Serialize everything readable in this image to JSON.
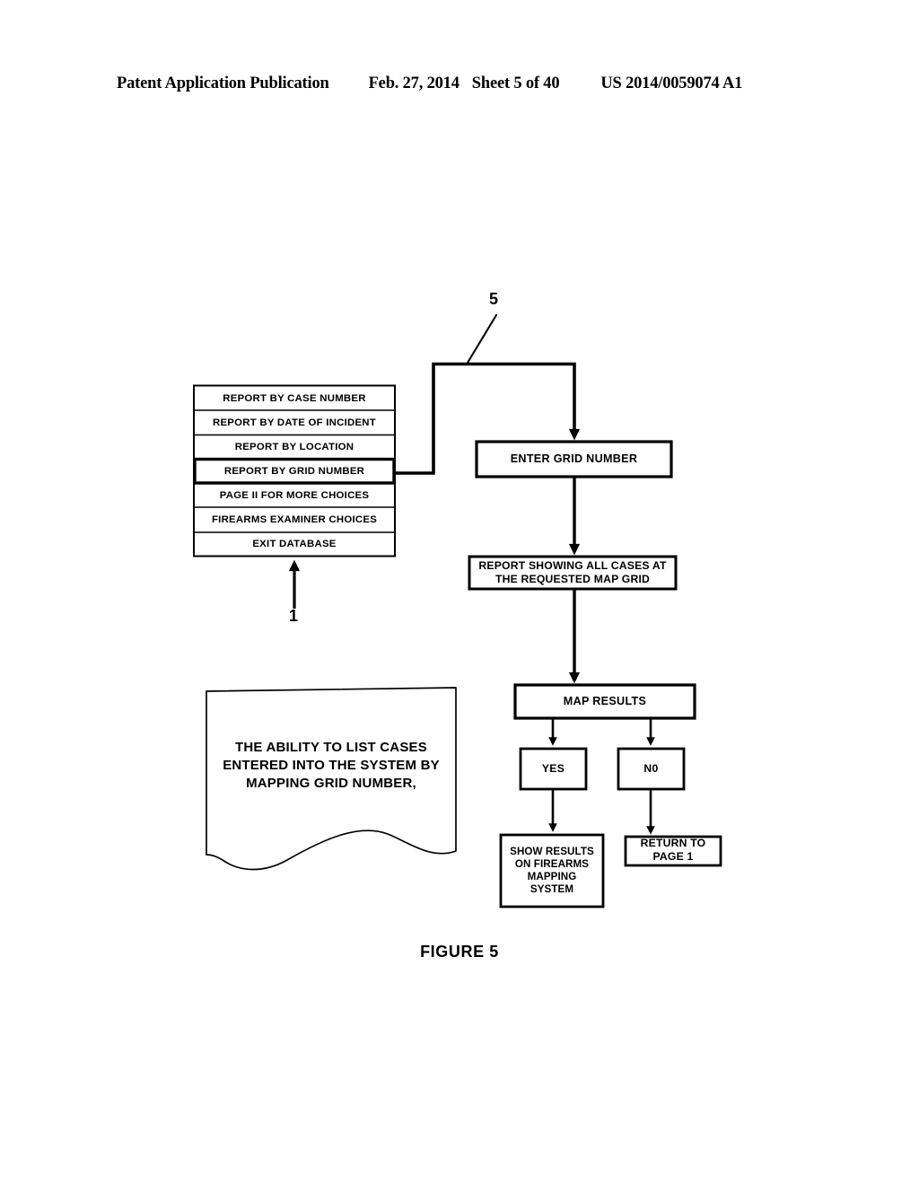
{
  "header": {
    "publication": "Patent Application Publication",
    "date": "Feb. 27, 2014",
    "sheet": "Sheet 5 of 40",
    "patent_number": "US 2014/0059074 A1"
  },
  "figure": {
    "caption": "FIGURE 5",
    "reference_numerals": [
      {
        "id": "ref-5",
        "label": "5"
      },
      {
        "id": "ref-1",
        "label": "1"
      }
    ]
  },
  "menu": {
    "name": "main-menu-list",
    "items": [
      {
        "label": "REPORT BY CASE NUMBER",
        "selected": false
      },
      {
        "label": "REPORT BY DATE OF INCIDENT",
        "selected": false
      },
      {
        "label": "REPORT BY LOCATION",
        "selected": false
      },
      {
        "label": "REPORT BY GRID NUMBER",
        "selected": true
      },
      {
        "label": "PAGE II FOR MORE CHOICES",
        "selected": false
      },
      {
        "label": "FIREARMS EXAMINER CHOICES",
        "selected": false
      },
      {
        "label": "EXIT DATABASE",
        "selected": false
      }
    ]
  },
  "nodes": {
    "enter_grid_number": "ENTER GRID NUMBER",
    "report_showing": "REPORT SHOWING ALL CASES AT\nTHE REQUESTED MAP GRID",
    "report_showing_line1": "REPORT SHOWING ALL CASES AT",
    "report_showing_line2": "THE REQUESTED MAP GRID",
    "map_results": "MAP RESULTS",
    "yes": "YES",
    "no": "N0",
    "show_results": "SHOW RESULTS ON FIREARMS MAPPING SYSTEM",
    "show_results_line1": "SHOW RESULTS",
    "show_results_line2": "ON FIREARMS",
    "show_results_line3": "MAPPING",
    "show_results_line4": "SYSTEM",
    "return_to_page": "RETURN TO PAGE 1",
    "return_to_page_line1": "RETURN TO",
    "return_to_page_line2": "PAGE 1"
  },
  "note": {
    "name": "torn-paper-note",
    "line1": "THE ABILITY TO LIST CASES",
    "line2": "ENTERED INTO THE SYSTEM BY",
    "line3": "MAPPING GRID NUMBER,"
  },
  "colors": {
    "ink": "#000000",
    "paper": "#ffffff"
  }
}
